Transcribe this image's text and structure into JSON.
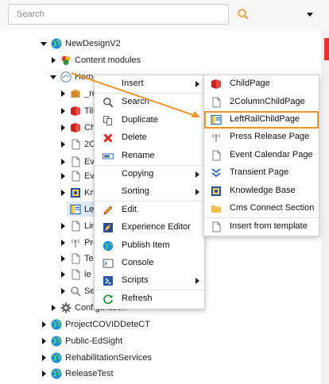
{
  "search": {
    "placeholder": "Search",
    "value": ""
  },
  "icons": {
    "search": "search-icon",
    "dropdown": "chevron-down-icon"
  },
  "tree": {
    "rows": [
      {
        "label": "NewDesignV2",
        "icon": "globe-icon"
      },
      {
        "label": "Content modules",
        "icon": "modules-icon"
      },
      {
        "label": "Home",
        "icon": "home-globe-icon"
      },
      {
        "label": "_re",
        "icon": "box-icon"
      },
      {
        "label": "Tile",
        "icon": "red-page-icon"
      },
      {
        "label": "Ch",
        "icon": "red-page-icon"
      },
      {
        "label": "2C",
        "icon": "page-icon"
      },
      {
        "label": "Eve",
        "icon": "page-icon"
      },
      {
        "label": "Eve",
        "icon": "page-icon"
      },
      {
        "label": "Kn",
        "icon": "knowledge-icon"
      },
      {
        "label": "Lef",
        "icon": "leftrail-icon"
      },
      {
        "label": "Lin",
        "icon": "page-icon"
      },
      {
        "label": "Pre",
        "icon": "press-icon"
      },
      {
        "label": "Tes",
        "icon": "page-icon"
      },
      {
        "label": "ie",
        "icon": "page-icon"
      },
      {
        "label": "Sea",
        "icon": "search-page-icon"
      },
      {
        "label": "Configuration",
        "icon": "gear-icon"
      },
      {
        "label": "ProjectCOVIDDeteCT",
        "icon": "globe-icon"
      },
      {
        "label": "Public-EdSight",
        "icon": "globe-icon"
      },
      {
        "label": "RehabilitationServices",
        "icon": "globe-icon"
      },
      {
        "label": "ReleaseTest",
        "icon": "globe-icon"
      }
    ]
  },
  "context_menu": {
    "items": [
      {
        "label": "Insert",
        "icon": "",
        "submenu": true
      },
      {
        "label": "Search",
        "icon": "search-icon",
        "submenu": false
      },
      {
        "label": "Duplicate",
        "icon": "duplicate-icon",
        "submenu": false
      },
      {
        "label": "Delete",
        "icon": "delete-icon",
        "submenu": false
      },
      {
        "label": "Rename",
        "icon": "rename-icon",
        "submenu": false
      },
      {
        "label": "Copying",
        "icon": "",
        "submenu": true
      },
      {
        "label": "Sorting",
        "icon": "",
        "submenu": true
      },
      {
        "label": "Edit",
        "icon": "edit-icon",
        "submenu": false
      },
      {
        "label": "Experience Editor",
        "icon": "experience-editor-icon",
        "submenu": false
      },
      {
        "label": "Publish Item",
        "icon": "publish-icon",
        "submenu": false
      },
      {
        "label": "Console",
        "icon": "console-icon",
        "submenu": false
      },
      {
        "label": "Scripts",
        "icon": "scripts-icon",
        "submenu": true
      },
      {
        "label": "Refresh",
        "icon": "refresh-icon",
        "submenu": false
      }
    ]
  },
  "insert_submenu": {
    "items": [
      {
        "label": "ChildPage",
        "icon": "red-page-icon"
      },
      {
        "label": "2ColumnChildPage",
        "icon": "page-icon"
      },
      {
        "label": "LeftRailChildPage",
        "icon": "leftrail-icon",
        "highlighted": true
      },
      {
        "label": "Press Release Page",
        "icon": "press-icon"
      },
      {
        "label": "Event Calendar Page",
        "icon": "page-icon"
      },
      {
        "label": "Transient Page",
        "icon": "transient-icon"
      },
      {
        "label": "Knowledge Base",
        "icon": "knowledge-icon"
      },
      {
        "label": "Cms Connect Section",
        "icon": "folder-icon"
      },
      {
        "label": "Insert from template",
        "icon": "page-icon"
      }
    ]
  },
  "colors": {
    "highlight": "#f0932b",
    "selection": "#dfe9f8"
  }
}
